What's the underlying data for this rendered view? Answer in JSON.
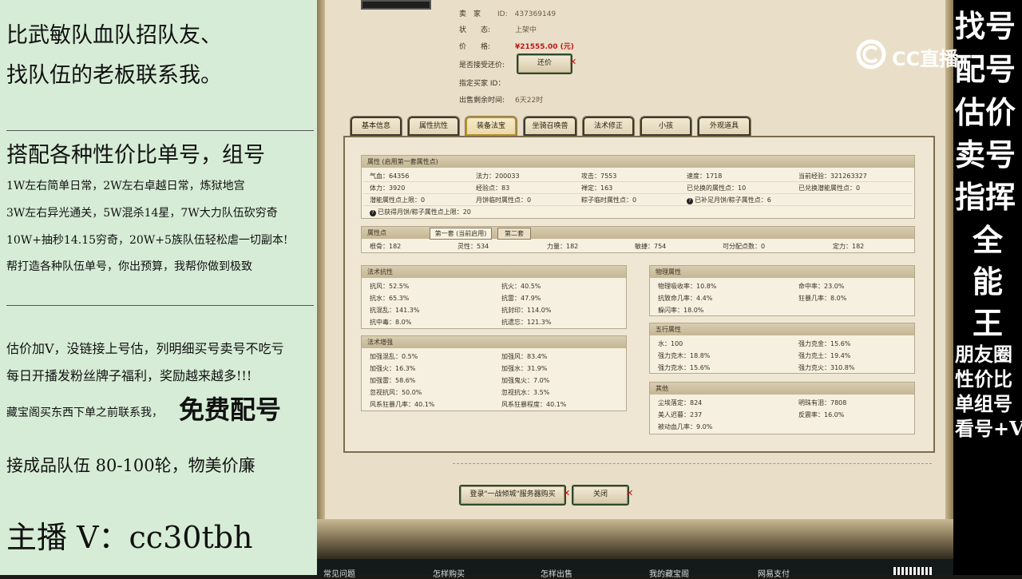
{
  "left": {
    "lines": [
      "比武敏队血队招队友、",
      "找队伍的老板联系我。",
      "搭配各种性价比单号，组号",
      "1W左右简单日常，2W左右卓越日常，炼狱地宫",
      "3W左右异光通关，5W混杀14星，7W大力队伍砍穷奇",
      "10W+抽秒14.15穷奇，20W+5族队伍轻松虐一切副本!",
      "帮打造各种队伍单号，你出预算，我帮你做到极致",
      "估价加V，没链接上号估，列明细买号卖号不吃亏",
      "每日开播发粉丝牌子福利，奖励越来越多!!!",
      "藏宝阁买东西下单之前联系我，",
      "免费配号",
      "接成品队伍 80-100轮，物美价廉",
      "主播 V：cc30tbh"
    ]
  },
  "right": {
    "big_chars": [
      "找号",
      "配号",
      "估价",
      "卖号",
      "指挥",
      "全",
      "能",
      "王"
    ],
    "small_lines": [
      "朋友圈",
      "性价比",
      "单组号",
      "看号+V"
    ],
    "logo_text": "CC直播"
  },
  "game": {
    "seller_info": [
      {
        "label": "卖　家",
        "value": "ID:　437369149"
      },
      {
        "label": "状　　态:",
        "value": "上架中"
      },
      {
        "label": "价　　格:",
        "value": "¥21555.00 (元)"
      },
      {
        "label": "是否接受还价:",
        "value": ""
      },
      {
        "label": "指定买家 ID：",
        "value": ""
      },
      {
        "label": "出售剩余时间:",
        "value": "6天22时"
      }
    ],
    "haggle_button": "还价",
    "tabs": [
      "基本信息",
      "属性抗性",
      "装备法宝",
      "坐骑召唤兽",
      "法术修正",
      "小孩",
      "外观道具"
    ],
    "attr_box": {
      "header": "属性 (启用第一套属性点)",
      "rows": [
        [
          "气血：64356",
          "法力：200033",
          "攻击：7553",
          "速度：1718",
          "当前经验：321263327"
        ],
        [
          "体力：3920",
          "经验点：83",
          "禅定：163",
          "已兑换的属性点：10",
          "已兑换潜能属性点：0"
        ],
        [
          "潜能属性点上限：0",
          "月饼临时属性点：0",
          "粽子临时属性点：0",
          "已补足月饼/粽子属性点：6",
          ""
        ],
        [
          "已获得月饼/粽子属性点上限：20",
          "",
          "",
          "",
          ""
        ]
      ]
    },
    "points_box": {
      "header": "属性点",
      "subtabs": [
        "第一套 (当前启用)",
        "第二套"
      ],
      "row": [
        "根骨：182",
        "灵性：534",
        "力量：182",
        "敏捷：754",
        "可分配点数：0",
        "定力：182"
      ]
    },
    "resist_box": {
      "header": "法术抗性",
      "rows": [
        [
          "抗风：52.5%",
          "抗火：40.5%"
        ],
        [
          "抗水：65.3%",
          "抗雷：47.9%"
        ],
        [
          "抗混乱：141.3%",
          "抗封印：114.0%"
        ],
        [
          "抗中毒：8.0%",
          "抗遗忘：121.3%"
        ]
      ]
    },
    "boost_box": {
      "header": "法术增强",
      "rows": [
        [
          "加强混乱：0.5%",
          "加强风：83.4%"
        ],
        [
          "加强火：16.3%",
          "加强水：31.9%"
        ],
        [
          "加强雷：58.6%",
          "加强鬼火：7.0%"
        ],
        [
          "忽视抗风：50.0%",
          "忽视抗水：3.5%"
        ],
        [
          "风系狂暴几率：40.1%",
          "风系狂暴程度：40.1%"
        ]
      ]
    },
    "phys_box": {
      "header": "物理属性",
      "rows": [
        [
          "物理吸收率：10.8%",
          "命中率：23.0%"
        ],
        [
          "抗致命几率：4.4%",
          "狂暴几率：8.0%"
        ],
        [
          "躲闪率：18.0%",
          ""
        ]
      ]
    },
    "wuxing_box": {
      "header": "五行属性",
      "rows": [
        [
          "水：100",
          "强力克金：15.6%"
        ],
        [
          "强力克木：18.8%",
          "强力克土：19.4%"
        ],
        [
          "强力克水：15.6%",
          "强力克火：310.8%"
        ]
      ]
    },
    "other_box": {
      "header": "其他",
      "rows": [
        [
          "尘埃落定：824",
          "明珠有泪：7808"
        ],
        [
          "美人迟暮：237",
          "反震率：16.0%"
        ],
        [
          "被动血几率：9.0%",
          ""
        ]
      ]
    },
    "buy_button": "登录\"一战倾城\"服务器购买",
    "close_button": "关闭",
    "footer": [
      "常见问题",
      "怎样购买",
      "怎样出售",
      "我的藏宝阁",
      "网易支付"
    ]
  },
  "colors": {
    "left_bg": "#d6ecd6",
    "game_bg": "#e9dfc8",
    "price": "#c01818",
    "right_bg": "#000000"
  }
}
